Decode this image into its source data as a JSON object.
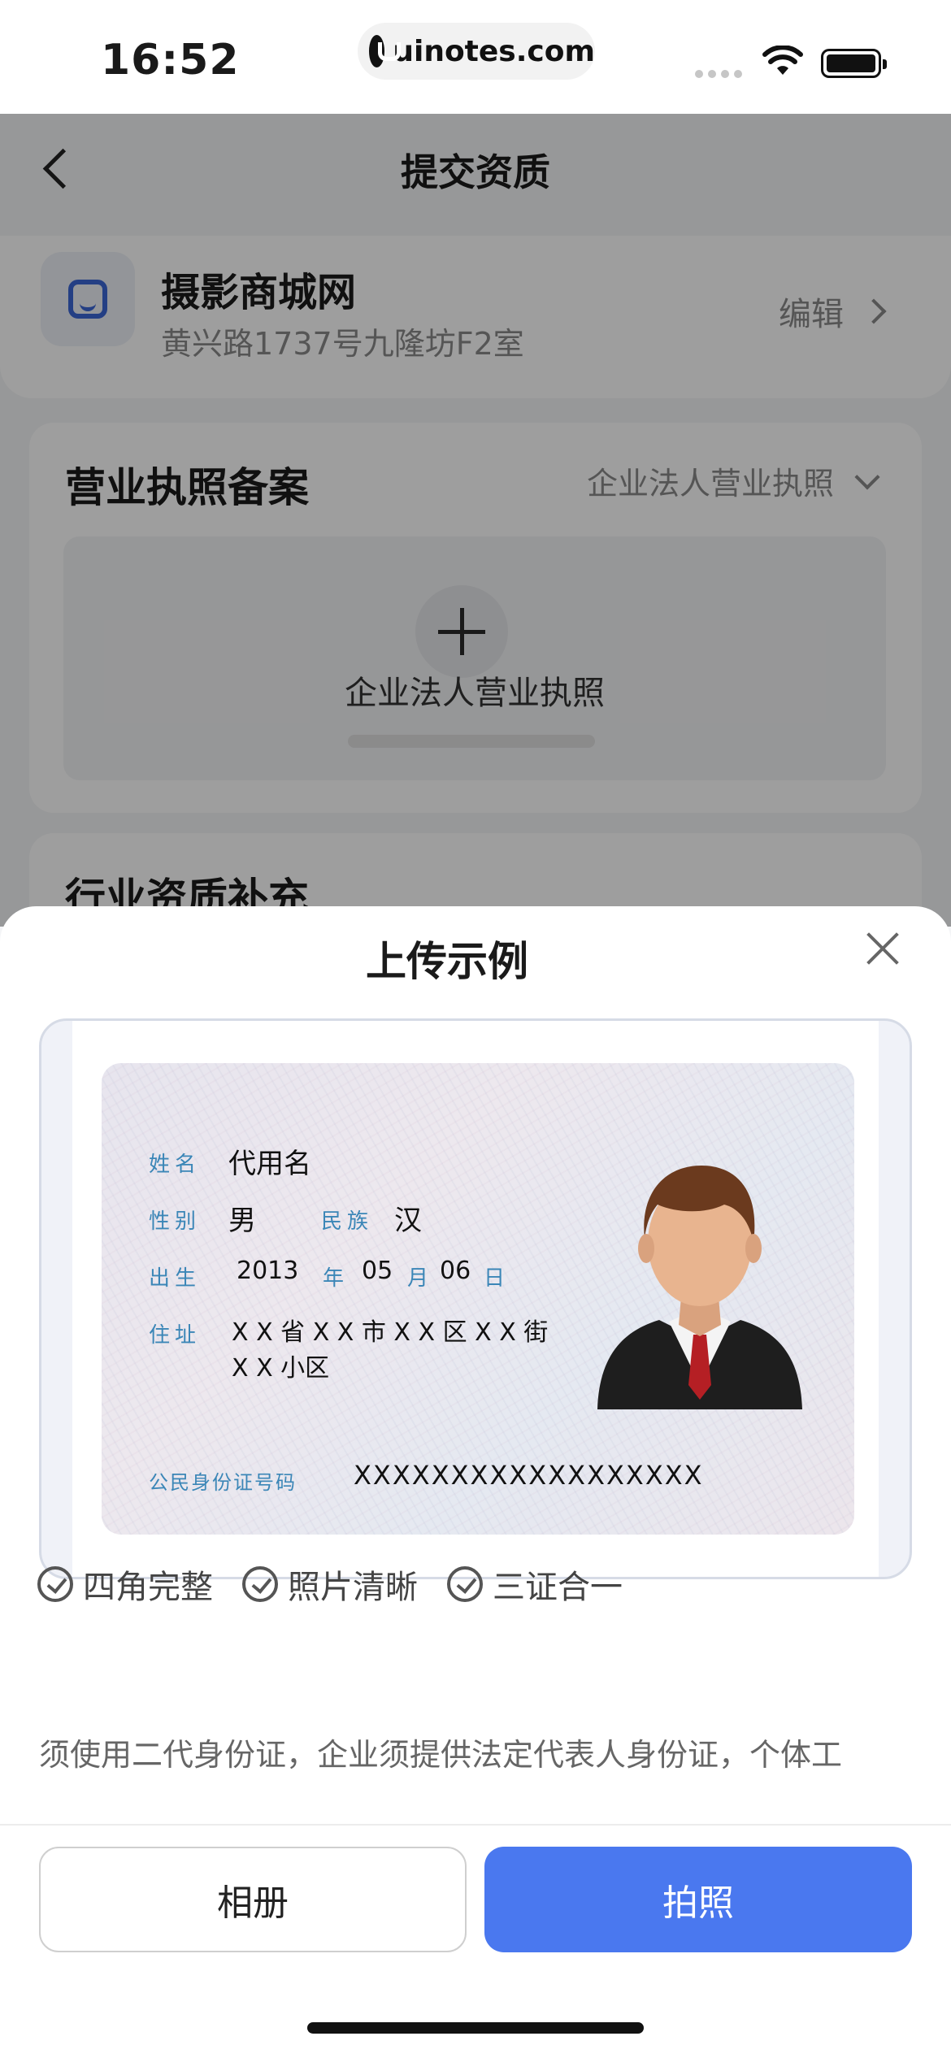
{
  "status_bar": {
    "time": "16:52",
    "url": "uinotes.com"
  },
  "page": {
    "title": "提交资质",
    "shop": {
      "name": "摄影商城网",
      "address": "黄兴路1737号九隆坊F2室",
      "edit_label": "编辑"
    },
    "license": {
      "title": "营业执照备案",
      "type": "企业法人营业执照",
      "upload_label": "企业法人营业执照"
    },
    "industry": {
      "title": "行业资质补充"
    }
  },
  "sheet": {
    "title": "上传示例",
    "id_card": {
      "name_label": "姓名",
      "name_value": "代用名",
      "gender_label": "性别",
      "gender_value": "男",
      "ethnicity_label": "民族",
      "ethnicity_value": "汉",
      "birth_label": "出生",
      "birth_year": "2013",
      "year_unit": "年",
      "birth_month": "05",
      "month_unit": "月",
      "birth_day": "06",
      "day_unit": "日",
      "address_label": "住址",
      "address_line1": "X X 省 X X 市 X X 区 X X 街",
      "address_line2": "X X 小区",
      "id_label": "公民身份证号码",
      "id_value": "XXXXXXXXXXXXXXXXXX"
    },
    "features": [
      "四角完整",
      "照片清晰",
      "三证合一"
    ],
    "notice": "须使用二代身份证，企业须提供法定代表人身份证，个体工",
    "album_button": "相册",
    "photo_button": "拍照"
  },
  "colors": {
    "primary": "#4a78ef",
    "id_label": "#3b86b7"
  }
}
